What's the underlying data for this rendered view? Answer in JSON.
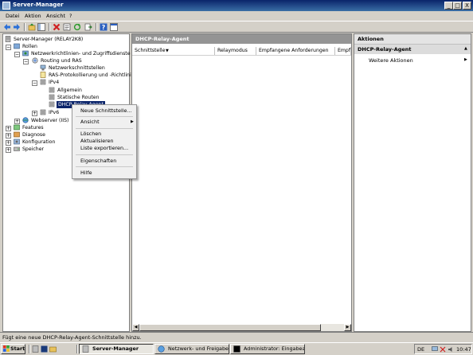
{
  "window": {
    "title": "Server-Manager",
    "controls": [
      "_",
      "□",
      "X"
    ]
  },
  "menu": [
    "Datei",
    "Aktion",
    "Ansicht",
    "?"
  ],
  "toolbar": {
    "icons": [
      "back-arrow-icon",
      "forward-arrow-icon",
      "up-folder-icon",
      "show-hide-tree-icon",
      "delete-icon",
      "properties-icon",
      "refresh-icon",
      "export-icon",
      "help-icon",
      "console-icon"
    ]
  },
  "tree": {
    "root": "Server-Manager (RELAY2K8)",
    "rollen": "Rollen",
    "nps": "Netzwerkrichtlinien- und Zugriffsdienste",
    "rras": "Routing und RAS",
    "netzwerk": "Netzwerkschnittstellen",
    "ras_log": "RAS-Protokollierung und -Richtlinien",
    "ipv4": "IPv4",
    "allgemein": "Allgemein",
    "statische": "Statische Routen",
    "dhcp": "DHCP-Relay-Agent",
    "ipv6": "IPv6",
    "webserver": "Webserver (IIS)",
    "features": "Features",
    "diagnose": "Diagnose",
    "konfiguration": "Konfiguration",
    "speicher": "Speicher"
  },
  "center": {
    "header": "DHCP-Relay-Agent",
    "columns": [
      "Schnittstelle",
      "Relaymodus",
      "Empfangene Anforderungen",
      "Empfa"
    ]
  },
  "actions": {
    "header": "Aktionen",
    "section": "DHCP-Relay-Agent",
    "item": "Weitere Aktionen"
  },
  "context_menu": {
    "new_interface": "Neue Schnittstelle...",
    "view": "Ansicht",
    "delete": "Löschen",
    "refresh": "Aktualisieren",
    "export": "Liste exportieren...",
    "properties": "Eigenschaften",
    "help": "Hilfe"
  },
  "status": "Fügt eine neue DHCP-Relay-Agent-Schnittstelle hinzu.",
  "taskbar": {
    "start": "Start",
    "tasks": [
      "Server-Manager",
      "Netzwerk- und Freigabec...",
      "Administrator: Eingabea..."
    ],
    "lang": "DE",
    "clock": "10:47"
  },
  "colors": {
    "title": "#0a246a",
    "header_gray": "#949494",
    "selection": "#0a246a"
  }
}
